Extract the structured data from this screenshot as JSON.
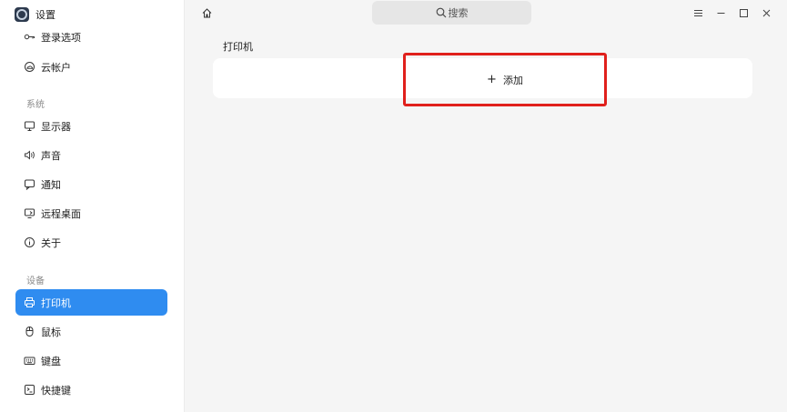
{
  "app": {
    "title": "设置",
    "icon": "settings-app-icon"
  },
  "sidebar": {
    "items_top": [
      {
        "label": "登录选项",
        "icon": "key-icon"
      },
      {
        "label": "云帐户",
        "icon": "cloud-account-icon"
      }
    ],
    "group_system": "系统",
    "items_system": [
      {
        "label": "显示器",
        "icon": "monitor-icon"
      },
      {
        "label": "声音",
        "icon": "speaker-icon"
      },
      {
        "label": "通知",
        "icon": "notification-icon"
      },
      {
        "label": "远程桌面",
        "icon": "remote-desktop-icon"
      },
      {
        "label": "关于",
        "icon": "info-icon"
      }
    ],
    "group_devices": "设备",
    "items_devices": [
      {
        "label": "打印机",
        "icon": "printer-icon",
        "active": true
      },
      {
        "label": "鼠标",
        "icon": "mouse-icon"
      },
      {
        "label": "键盘",
        "icon": "keyboard-icon"
      },
      {
        "label": "快捷键",
        "icon": "shortcut-icon"
      }
    ]
  },
  "topbar": {
    "search_placeholder": "搜索",
    "home_icon": "home-icon",
    "menu_icon": "menu-icon",
    "minimize_icon": "minimize-icon",
    "maximize_icon": "maximize-icon",
    "close_icon": "close-icon"
  },
  "main": {
    "section_title": "打印机",
    "add_label": "添加",
    "add_symbol": "+"
  },
  "colors": {
    "accent": "#2f8cf0",
    "highlight_border": "#e0201c"
  }
}
